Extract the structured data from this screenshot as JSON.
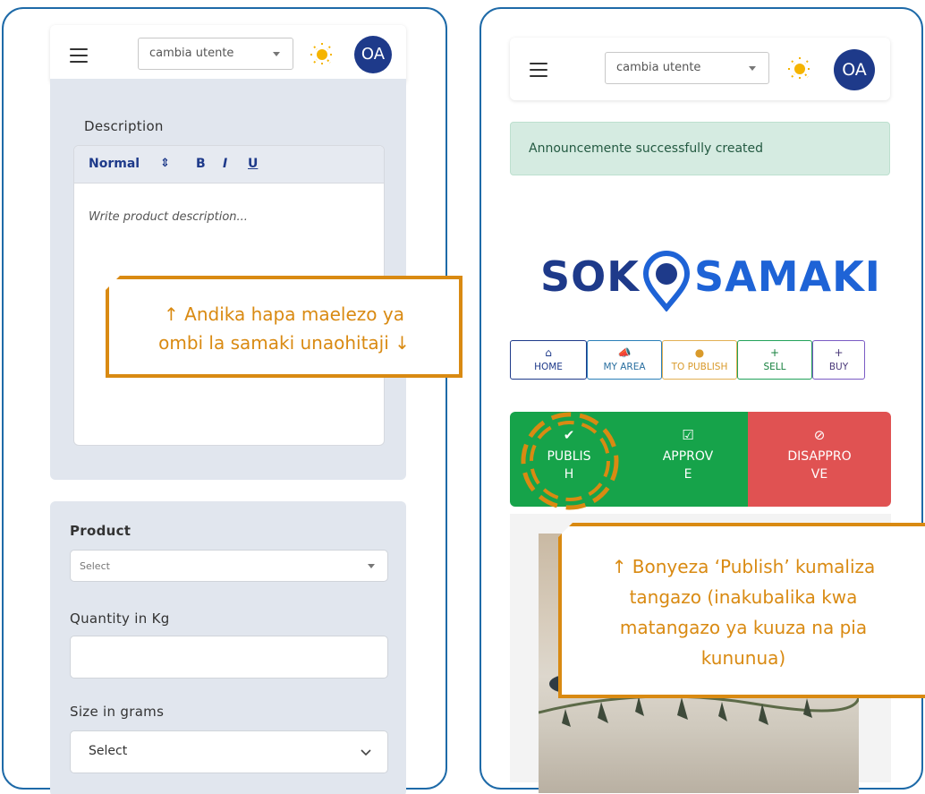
{
  "left_screen": {
    "topbar": {
      "user_select": "cambia utente",
      "avatar": "OA"
    },
    "description_label": "Description",
    "editor": {
      "format": "Normal",
      "format_arrows": "⇕",
      "bold": "B",
      "italic": "I",
      "underline": "U",
      "placeholder": "Write product description..."
    },
    "product_label": "Product",
    "product_select": "Select",
    "quantity_label": "Quantity in Kg",
    "size_label": "Size in grams",
    "size_select": "Select"
  },
  "right_screen": {
    "topbar": {
      "user_select": "cambia utente",
      "avatar": "OA"
    },
    "alert": "Announcemente successfully created",
    "logo": {
      "part1": "SOK",
      "part2": "SAMAKI"
    },
    "nav": [
      {
        "label": "HOME",
        "icon": "home-icon"
      },
      {
        "label": "MY AREA",
        "icon": "megaphone-icon"
      },
      {
        "label": "TO PUBLISH",
        "icon": "check-circle-icon"
      },
      {
        "label": "SELL",
        "icon": "plus-icon"
      },
      {
        "label": "BUY",
        "icon": "plus-icon"
      }
    ],
    "actions": {
      "publish_line1": "PUBLIS",
      "publish_line2": "H",
      "approve_line1": "APPROV",
      "approve_line2": "E",
      "disapprove_line1": "DISAPPRO",
      "disapprove_line2": "VE"
    }
  },
  "callouts": {
    "left_line1": "↑ Andika hapa maelezo ya",
    "left_line2": "ombi la samaki unaohitaji ↓",
    "right_line1": "↑ Bonyeza ‘Publish’ kumaliza",
    "right_line2": "tangazo (inakubalika kwa",
    "right_line3": "matangazo ya kuuza na pia",
    "right_line4": "kununua)"
  },
  "colors": {
    "frame": "#1e6aa8",
    "accent_orange": "#d98a12",
    "avatar_blue": "#1e3a8a",
    "publish_green": "#16a34a",
    "disapprove_red": "#e05252",
    "logo_navy": "#1e3a8a",
    "logo_blue": "#1e63d6"
  }
}
